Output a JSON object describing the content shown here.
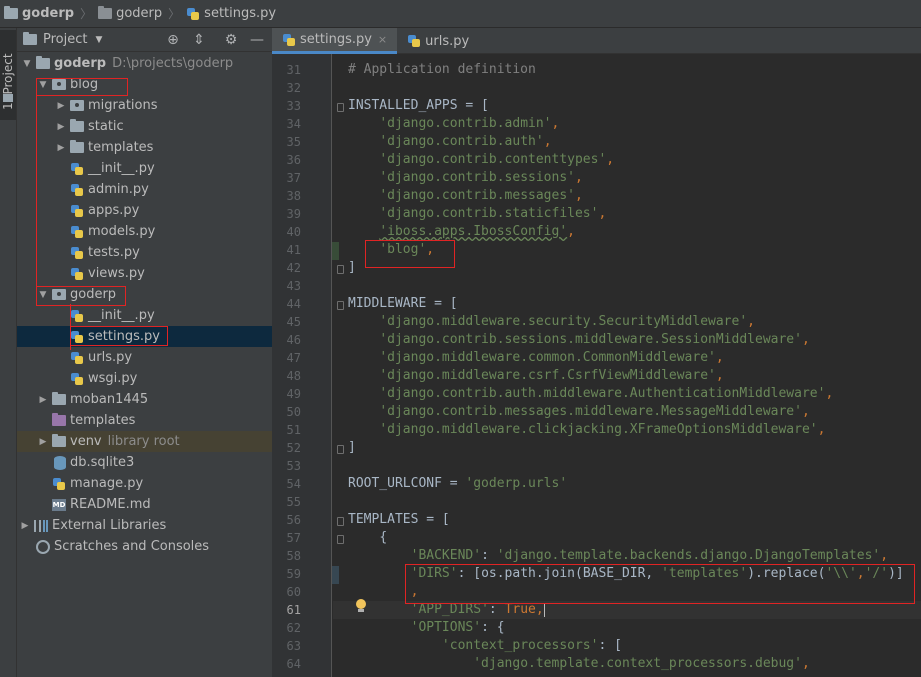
{
  "breadcrumb": [
    "goderp",
    "goderp",
    "settings.py"
  ],
  "tool_strip": {
    "project_tab": "1: Project"
  },
  "project_panel": {
    "title": "Project",
    "tree": [
      {
        "label": "goderp",
        "sub": "D:\\projects\\goderp"
      },
      {
        "label": "blog"
      },
      {
        "label": "migrations"
      },
      {
        "label": "static"
      },
      {
        "label": "templates"
      },
      {
        "label": "__init__.py"
      },
      {
        "label": "admin.py"
      },
      {
        "label": "apps.py"
      },
      {
        "label": "models.py"
      },
      {
        "label": "tests.py"
      },
      {
        "label": "views.py"
      },
      {
        "label": "goderp"
      },
      {
        "label": "__init__.py"
      },
      {
        "label": "settings.py"
      },
      {
        "label": "urls.py"
      },
      {
        "label": "wsgi.py"
      },
      {
        "label": "moban1445"
      },
      {
        "label": "templates"
      },
      {
        "label": "venv",
        "sub": "library root"
      },
      {
        "label": "db.sqlite3"
      },
      {
        "label": "manage.py"
      },
      {
        "label": "README.md"
      },
      {
        "label": "External Libraries"
      },
      {
        "label": "Scratches and Consoles"
      }
    ]
  },
  "tabs": [
    {
      "label": "settings.py",
      "close": "×"
    },
    {
      "label": "urls.py",
      "close": ""
    }
  ],
  "editor": {
    "line_numbers": [
      "31",
      "32",
      "33",
      "34",
      "35",
      "36",
      "37",
      "38",
      "39",
      "40",
      "41",
      "42",
      "43",
      "44",
      "45",
      "46",
      "47",
      "48",
      "49",
      "50",
      "51",
      "52",
      "53",
      "54",
      "55",
      "56",
      "57",
      "58",
      "59",
      "60",
      "61",
      "62",
      "63",
      "64"
    ],
    "lines": {
      "l31": "# Application definition",
      "l33a": "INSTALLED_APPS = [",
      "l34": "'django.contrib.admin'",
      "l35": "'django.contrib.auth'",
      "l36": "'django.contrib.contenttypes'",
      "l37": "'django.contrib.sessions'",
      "l38": "'django.contrib.messages'",
      "l39": "'django.contrib.staticfiles'",
      "l40": "'iboss.apps.IbossConfig'",
      "l41": "'blog'",
      "l42": "]",
      "l44": "MIDDLEWARE = [",
      "l45": "'django.middleware.security.SecurityMiddleware'",
      "l46": "'django.contrib.sessions.middleware.SessionMiddleware'",
      "l47": "'django.middleware.common.CommonMiddleware'",
      "l48": "'django.middleware.csrf.CsrfViewMiddleware'",
      "l49": "'django.contrib.auth.middleware.AuthenticationMiddleware'",
      "l50": "'django.contrib.messages.middleware.MessageMiddleware'",
      "l51": "'django.middleware.clickjacking.XFrameOptionsMiddleware'",
      "l52": "]",
      "l54a": "ROOT_URLCONF = ",
      "l54b": "'goderp.urls'",
      "l56": "TEMPLATES = [",
      "l57": "{",
      "l58a": "'BACKEND'",
      "l58b": "'django.template.backends.django.DjangoTemplates'",
      "l59a": "'DIRS'",
      "l59b": ": [os.path.join(BASE_DIR, ",
      "l59c": "'templates'",
      "l59d": ").replace(",
      "l59e": "'\\\\'",
      "l59f": "'/'",
      "l59g": ")]",
      "l60": ",",
      "l61a": "'APP_DIRS'",
      "l61b": ": ",
      "l61c": "True",
      "l62a": "'OPTIONS'",
      "l62b": ": {",
      "l63a": "'context_processors'",
      "l63b": ": [",
      "l64": "'django.template.context_processors.debug'"
    }
  },
  "colors": {
    "highlight_box": "#e02424",
    "selection": "#0d293e",
    "string": "#6a8759",
    "keyword": "#cc7832"
  }
}
